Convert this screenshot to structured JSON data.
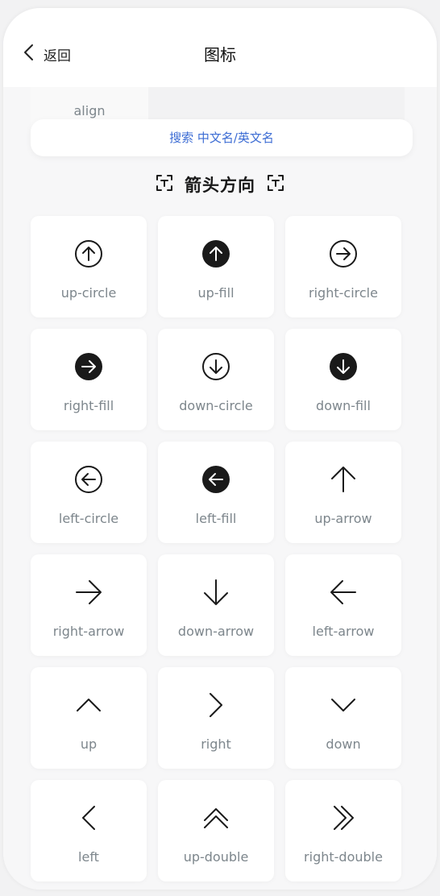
{
  "nav": {
    "back_label": "返回",
    "title": "图标"
  },
  "previous_section": {
    "visible_item": "align"
  },
  "search": {
    "placeholder": "搜索 中文名/英文名"
  },
  "section": {
    "title": "箭头方向"
  },
  "icons": [
    {
      "label": "up-circle",
      "icon": "up-circle-icon"
    },
    {
      "label": "up-fill",
      "icon": "up-fill-icon"
    },
    {
      "label": "right-circle",
      "icon": "right-circle-icon"
    },
    {
      "label": "right-fill",
      "icon": "right-fill-icon"
    },
    {
      "label": "down-circle",
      "icon": "down-circle-icon"
    },
    {
      "label": "down-fill",
      "icon": "down-fill-icon"
    },
    {
      "label": "left-circle",
      "icon": "left-circle-icon"
    },
    {
      "label": "left-fill",
      "icon": "left-fill-icon"
    },
    {
      "label": "up-arrow",
      "icon": "up-arrow-icon"
    },
    {
      "label": "right-arrow",
      "icon": "right-arrow-icon"
    },
    {
      "label": "down-arrow",
      "icon": "down-arrow-icon"
    },
    {
      "label": "left-arrow",
      "icon": "left-arrow-icon"
    },
    {
      "label": "up",
      "icon": "up-icon"
    },
    {
      "label": "right",
      "icon": "right-icon"
    },
    {
      "label": "down",
      "icon": "down-icon"
    },
    {
      "label": "left",
      "icon": "left-icon"
    },
    {
      "label": "up-double",
      "icon": "up-double-icon"
    },
    {
      "label": "right-double",
      "icon": "right-double-icon"
    }
  ],
  "colors": {
    "accent": "#3c6cd4",
    "icon": "#1a1a1a",
    "label": "#7d868c"
  }
}
